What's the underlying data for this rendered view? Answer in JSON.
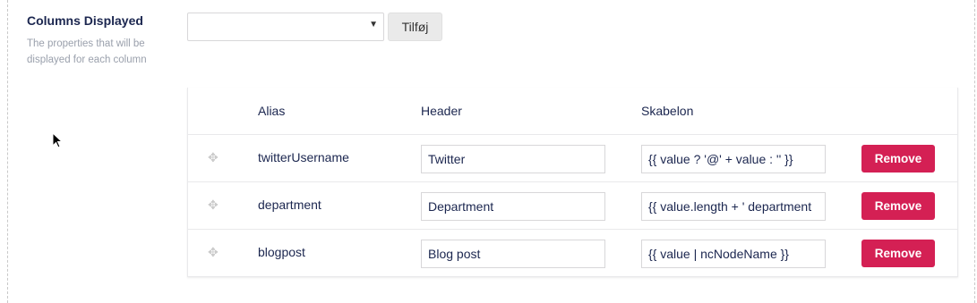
{
  "property": {
    "title": "Columns Displayed",
    "description": "The properties that will be displayed for each column"
  },
  "picker": {
    "selected": "",
    "add_label": "Tilføj"
  },
  "table": {
    "headers": {
      "alias": "Alias",
      "header": "Header",
      "template": "Skabelon"
    },
    "rows": [
      {
        "alias": "twitterUsername",
        "header": "Twitter",
        "template": "{{ value ? '@' + value : '' }}",
        "remove_label": "Remove"
      },
      {
        "alias": "department",
        "header": "Department",
        "template": "{{ value.length + ' department",
        "remove_label": "Remove"
      },
      {
        "alias": "blogpost",
        "header": "Blog post",
        "template": "{{ value | ncNodeName }}",
        "remove_label": "Remove"
      }
    ]
  },
  "icons": {
    "drag_handle": "move-icon",
    "select_caret": "caret-down-icon",
    "cursor": "mouse-pointer-icon"
  },
  "colors": {
    "remove_button": "#d42054",
    "text": "#1b264f",
    "muted_text": "#9aa0ac"
  }
}
